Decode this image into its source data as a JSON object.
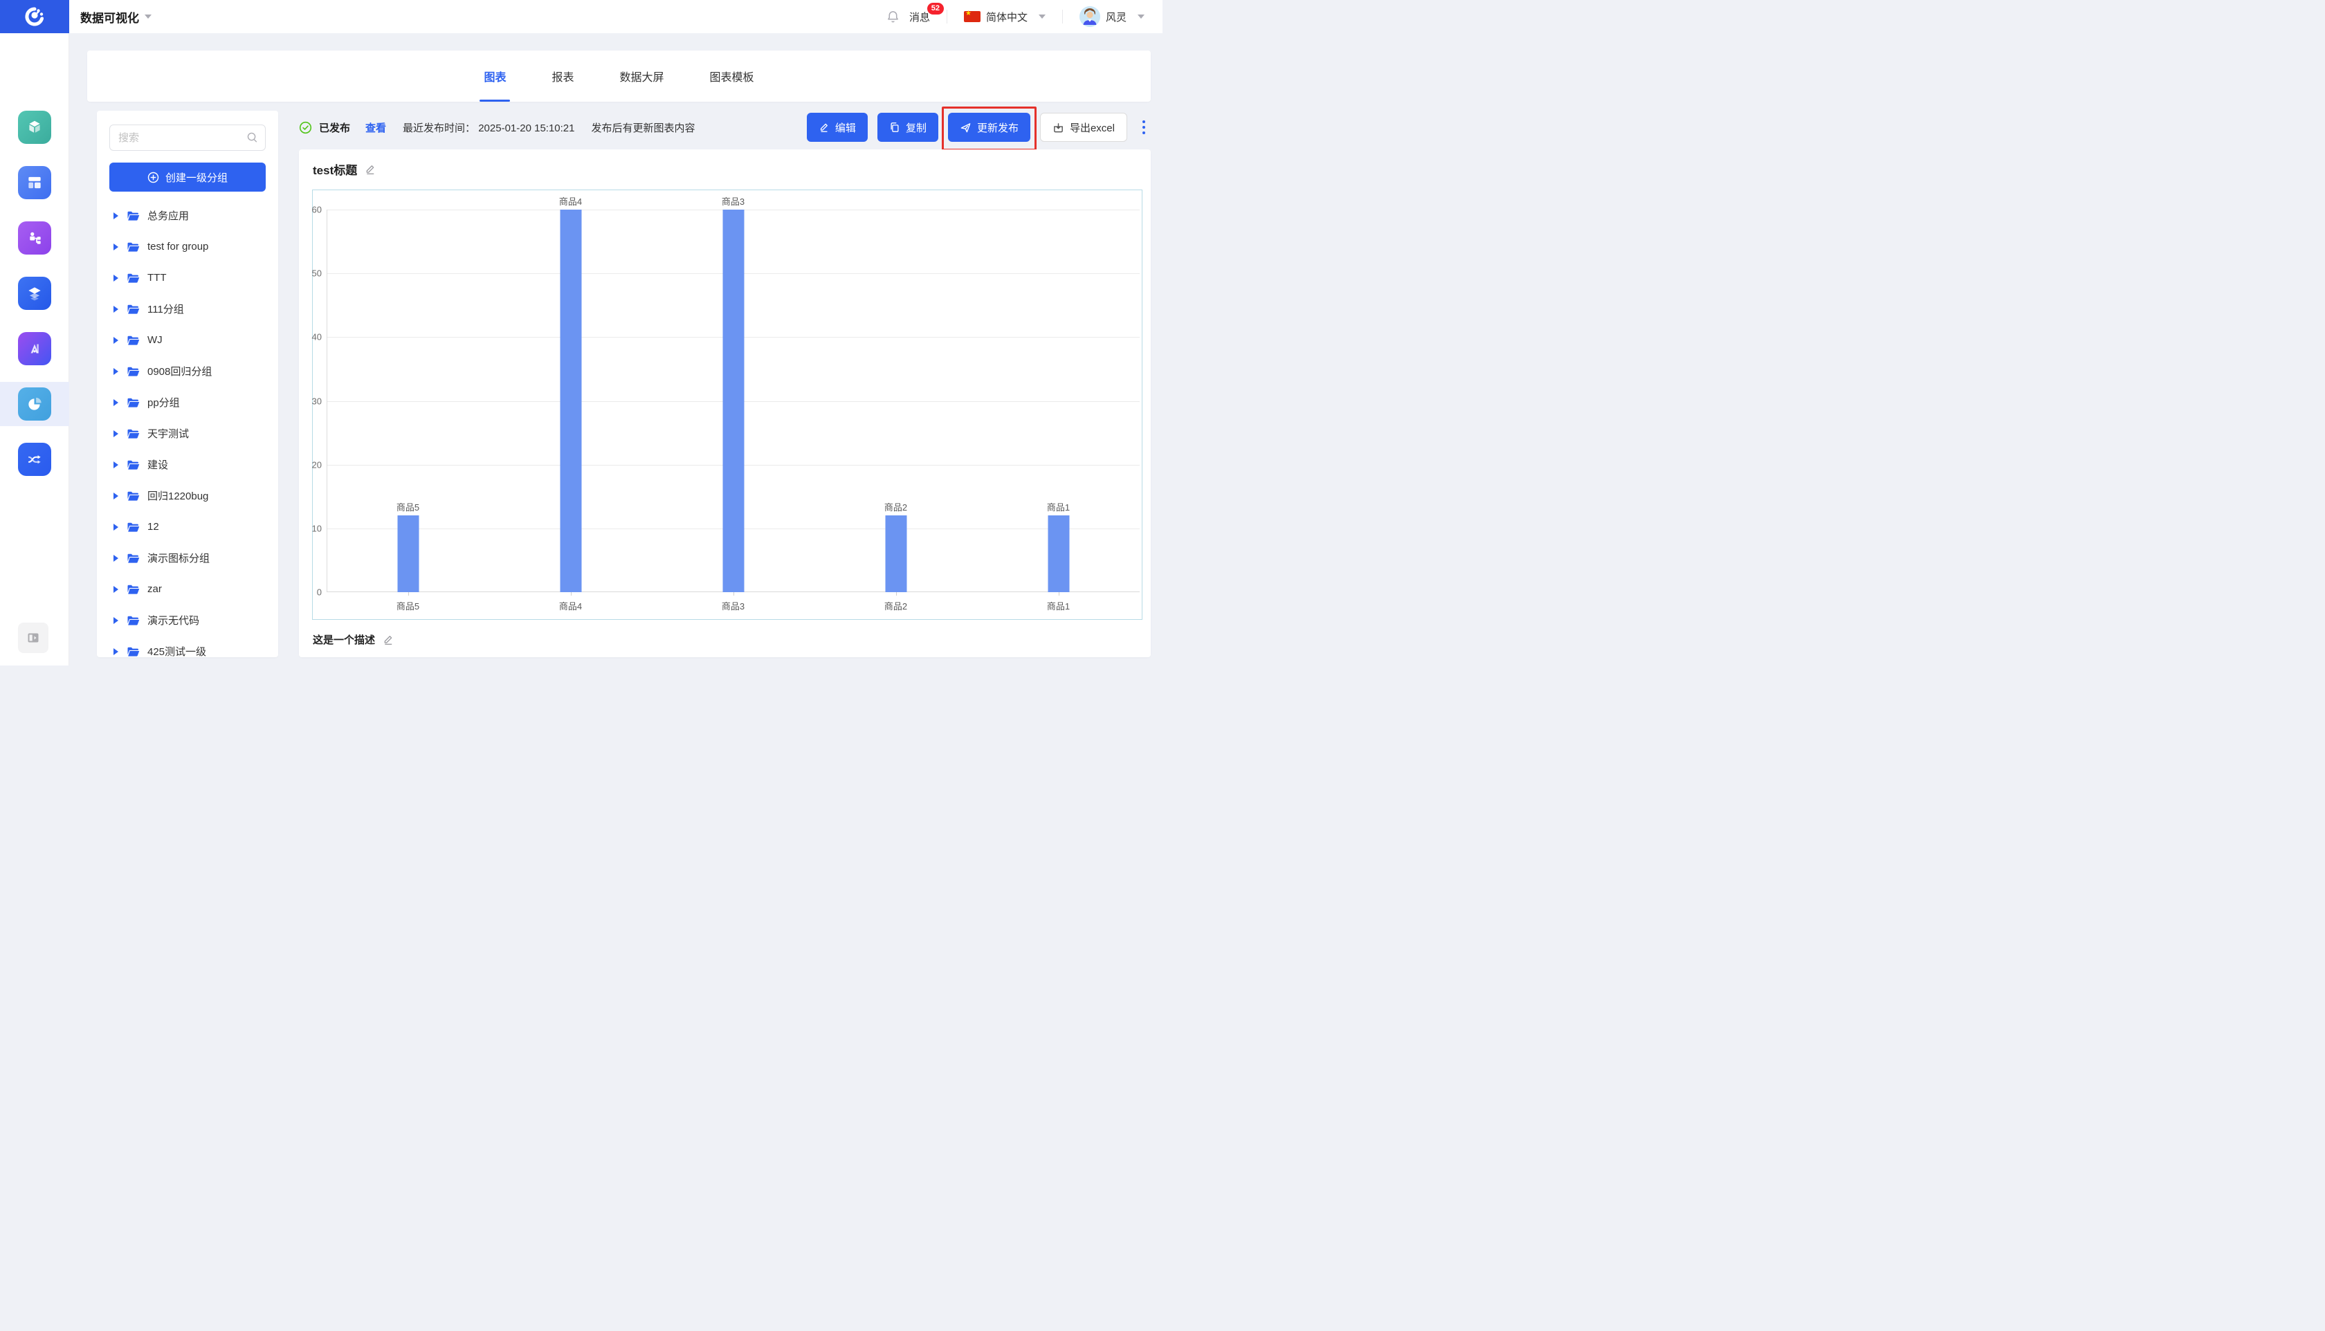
{
  "header": {
    "app_title": "数据可视化",
    "messages_label": "消息",
    "messages_count": "52",
    "language_label": "简体中文",
    "user_name": "风灵"
  },
  "rail": {
    "items": [
      {
        "name": "cube-app",
        "active": false
      },
      {
        "name": "layout-app",
        "active": false
      },
      {
        "name": "flow-app",
        "active": false
      },
      {
        "name": "layers-app",
        "active": false
      },
      {
        "name": "ai-app",
        "active": false
      },
      {
        "name": "chart-app",
        "active": true
      },
      {
        "name": "shuffle-app",
        "active": false
      }
    ]
  },
  "tabs": [
    {
      "label": "图表",
      "active": true
    },
    {
      "label": "报表",
      "active": false
    },
    {
      "label": "数据大屏",
      "active": false
    },
    {
      "label": "图表模板",
      "active": false
    }
  ],
  "status": {
    "published_label": "已发布",
    "view_link": "查看",
    "publish_time_text": "最近发布时间：  2025-01-20 15:10:21",
    "update_hint": "发布后有更新图表内容"
  },
  "actions": {
    "edit_label": "编辑",
    "copy_label": "复制",
    "update_publish_label": "更新发布",
    "export_excel_label": "导出excel"
  },
  "panel": {
    "search_placeholder": "搜索",
    "create_group_label": "创建一级分组",
    "tree": [
      "总务应用",
      "test for group",
      "TTT",
      "111分组",
      "WJ",
      "0908回归分组",
      "pp分组",
      "天宇测试",
      "建设",
      "回归1220bug",
      "12",
      "演示图标分组",
      "zar",
      "演示无代码",
      "425测试一级"
    ]
  },
  "chart": {
    "title": "test标题",
    "description": "这是一个描述"
  },
  "chart_data": {
    "type": "bar",
    "title": "test标题",
    "categories": [
      "商品5",
      "商品4",
      "商品3",
      "商品2",
      "商品1"
    ],
    "values": [
      12,
      60,
      60,
      12,
      12
    ],
    "xlabel": "",
    "ylabel": "",
    "ylim": [
      0,
      60
    ],
    "yticks": [
      0,
      10,
      20,
      30,
      40,
      50,
      60
    ],
    "grid": true,
    "legend": false,
    "bar_label_style": "category name above each bar"
  },
  "colors": {
    "accent": "#2E62F0",
    "brand": "#2D5AE5",
    "bar": "#6B94F2",
    "annotation": "#E5312B",
    "badge": "#F5222D",
    "success": "#52C41A",
    "chart-border": "#B7DBE6",
    "rail-active": "#E9EDFB",
    "page-bg": "#EFF1F6"
  }
}
